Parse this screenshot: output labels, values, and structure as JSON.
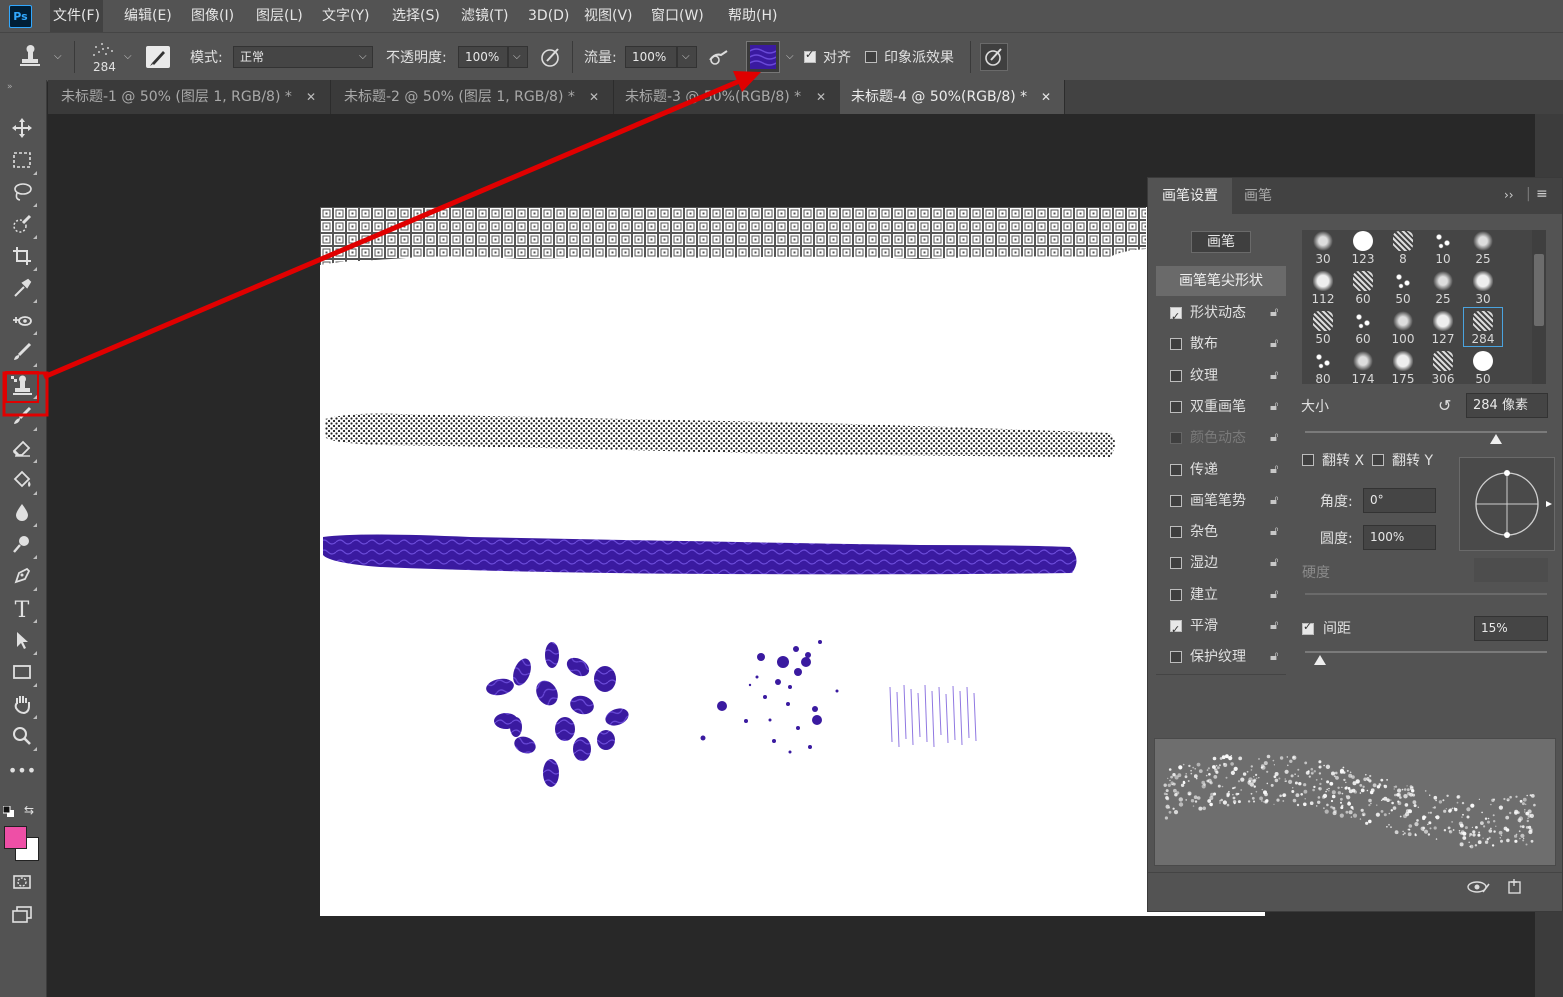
{
  "app": {
    "logo": "Ps"
  },
  "menu": [
    "文件(F)",
    "编辑(E)",
    "图像(I)",
    "图层(L)",
    "文字(Y)",
    "选择(S)",
    "滤镜(T)",
    "3D(D)",
    "视图(V)",
    "窗口(W)",
    "帮助(H)"
  ],
  "options": {
    "brush_size": "284",
    "mode_label": "模式:",
    "mode_value": "正常",
    "opacity_label": "不透明度:",
    "opacity_value": "100%",
    "flow_label": "流量:",
    "flow_value": "100%",
    "align_label": "对齐",
    "align_checked": true,
    "impressionist_label": "印象派效果",
    "impressionist_checked": false,
    "pattern_color": "#3a1aa0"
  },
  "tabs": [
    {
      "label": "未标题-1 @ 50% (图层 1, RGB/8) *",
      "active": false
    },
    {
      "label": "未标题-2 @ 50% (图层 1, RGB/8) *",
      "active": false
    },
    {
      "label": "未标题-3 @ 50%(RGB/8) *",
      "active": false
    },
    {
      "label": "未标题-4 @ 50%(RGB/8) *",
      "active": true
    }
  ],
  "tools": [
    "move-tool",
    "marquee-tool",
    "lasso-tool",
    "quick-select-tool",
    "crop-tool",
    "eyedropper-tool",
    "healing-tool",
    "brush-tool",
    "pattern-stamp-tool",
    "history-brush-tool",
    "eraser-tool",
    "paint-bucket-tool",
    "blur-tool",
    "dodge-tool",
    "pen-tool",
    "type-tool",
    "path-select-tool",
    "rectangle-tool",
    "hand-tool",
    "zoom-tool",
    "more-tools"
  ],
  "colors": {
    "foreground": "#ee4fa6",
    "background": "#ffffff",
    "highlight": "#e00000",
    "brush_purple": "#3a1aa0"
  },
  "brush_panel": {
    "tabs": [
      "画笔设置",
      "画笔"
    ],
    "brushes_button": "画笔",
    "tip_shape_label": "画笔笔尖形状",
    "settings": [
      {
        "label": "形状动态",
        "checked": true,
        "disabled": false
      },
      {
        "label": "散布",
        "checked": false,
        "disabled": false
      },
      {
        "label": "纹理",
        "checked": false,
        "disabled": false
      },
      {
        "label": "双重画笔",
        "checked": false,
        "disabled": false
      },
      {
        "label": "颜色动态",
        "checked": false,
        "disabled": true
      },
      {
        "label": "传递",
        "checked": false,
        "disabled": false
      },
      {
        "label": "画笔笔势",
        "checked": false,
        "disabled": false
      },
      {
        "label": "杂色",
        "checked": false,
        "disabled": false
      },
      {
        "label": "湿边",
        "checked": false,
        "disabled": false
      },
      {
        "label": "建立",
        "checked": false,
        "disabled": false
      },
      {
        "label": "平滑",
        "checked": true,
        "disabled": false
      },
      {
        "label": "保护纹理",
        "checked": false,
        "disabled": false
      }
    ],
    "presets": [
      [
        "30",
        "123",
        "8",
        "10",
        "25"
      ],
      [
        "112",
        "60",
        "50",
        "25",
        "30"
      ],
      [
        "50",
        "60",
        "100",
        "127",
        "284"
      ],
      [
        "80",
        "174",
        "175",
        "306",
        "50"
      ]
    ],
    "size_label": "大小",
    "size_value": "284 像素",
    "flip_x_label": "翻转 X",
    "flip_y_label": "翻转 Y",
    "angle_label": "角度:",
    "angle_value": "0°",
    "roundness_label": "圆度:",
    "roundness_value": "100%",
    "hardness_label": "硬度",
    "spacing_label": "间距",
    "spacing_checked": true,
    "spacing_value": "15%"
  }
}
